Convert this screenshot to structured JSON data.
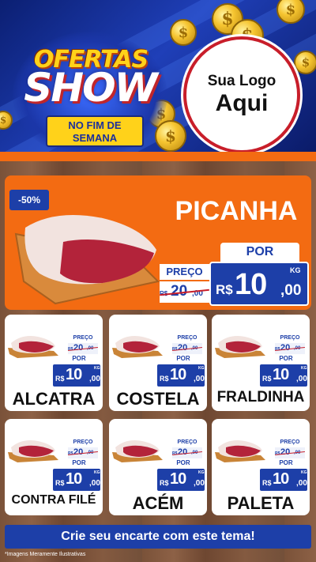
{
  "header": {
    "brand_line1": "OFERTAS",
    "brand_line2": "SHOW",
    "weekend_l1": "NO FIM DE",
    "weekend_l2": "SEMANA",
    "logo_l1": "Sua Logo",
    "logo_l2": "Aqui",
    "coin_symbol": "$"
  },
  "featured": {
    "discount": "-50%",
    "name": "PICANHA",
    "preco_label": "PREÇO",
    "old_rs": "R$",
    "old_int": "20",
    "old_dec": ",00",
    "por_label": "POR",
    "new_rs": "R$",
    "new_int": "10",
    "new_dec": ",00",
    "unit": "KG"
  },
  "products": [
    {
      "name": "ALCATRA",
      "preco_label": "PREÇO",
      "old_rs": "R$",
      "old_int": "20",
      "old_dec": ",00",
      "por_label": "POR",
      "new_rs": "R$",
      "new_int": "10",
      "new_dec": ",00",
      "unit": "KG"
    },
    {
      "name": "COSTELA",
      "preco_label": "PREÇO",
      "old_rs": "R$",
      "old_int": "20",
      "old_dec": ",00",
      "por_label": "POR",
      "new_rs": "R$",
      "new_int": "10",
      "new_dec": ",00",
      "unit": "KG"
    },
    {
      "name": "FRALDINHA",
      "preco_label": "PREÇO",
      "old_rs": "R$",
      "old_int": "20",
      "old_dec": ",00",
      "por_label": "POR",
      "new_rs": "R$",
      "new_int": "10",
      "new_dec": ",00",
      "unit": "KG"
    },
    {
      "name": "CONTRA FILÉ",
      "preco_label": "PREÇO",
      "old_rs": "R$",
      "old_int": "20",
      "old_dec": ",00",
      "por_label": "POR",
      "new_rs": "R$",
      "new_int": "10",
      "new_dec": ",00",
      "unit": "KG"
    },
    {
      "name": "ACÉM",
      "preco_label": "PREÇO",
      "old_rs": "R$",
      "old_int": "20",
      "old_dec": ",00",
      "por_label": "POR",
      "new_rs": "R$",
      "new_int": "10",
      "new_dec": ",00",
      "unit": "KG"
    },
    {
      "name": "PALETA",
      "preco_label": "PREÇO",
      "old_rs": "R$",
      "old_int": "20",
      "old_dec": ",00",
      "por_label": "POR",
      "new_rs": "R$",
      "new_int": "10",
      "new_dec": ",00",
      "unit": "KG"
    }
  ],
  "footer": {
    "cta": "Crie seu encarte com este tema!",
    "disclaimer": "*Imagens Meramente Ilustrativas"
  },
  "colors": {
    "blue": "#1d3fa8",
    "orange": "#f36b12",
    "gold": "#ffd21a",
    "red": "#c81e2a",
    "meat": "#b3233a",
    "fat": "#f2e3df"
  },
  "icons": {
    "coin": "gold-coin-icon",
    "meat": "meat-cut-icon",
    "board": "cutting-board-icon"
  }
}
